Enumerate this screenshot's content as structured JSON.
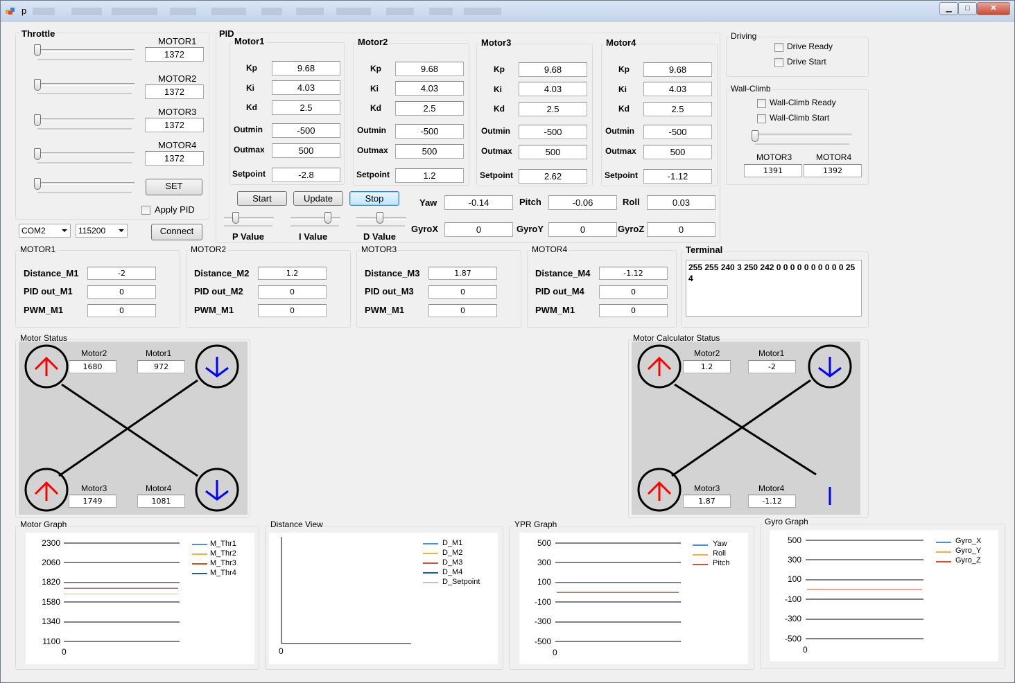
{
  "window": {
    "title": "p"
  },
  "throttle": {
    "title": "Throttle",
    "motors": [
      {
        "label": "MOTOR1",
        "value": "1372"
      },
      {
        "label": "MOTOR2",
        "value": "1372"
      },
      {
        "label": "MOTOR3",
        "value": "1372"
      },
      {
        "label": "MOTOR4",
        "value": "1372"
      }
    ],
    "set_label": "SET",
    "apply_pid_label": "Apply PID",
    "com_port": "COM2",
    "baud_rate": "115200",
    "connect_label": "Connect"
  },
  "pid": {
    "title": "PID",
    "motors": [
      {
        "title": "Motor1",
        "kp": "9.68",
        "ki": "4.03",
        "kd": "2.5",
        "outmin": "-500",
        "outmax": "500",
        "setpoint": "-2.8"
      },
      {
        "title": "Motor2",
        "kp": "9.68",
        "ki": "4.03",
        "kd": "2.5",
        "outmin": "-500",
        "outmax": "500",
        "setpoint": "1.2"
      },
      {
        "title": "Motor3",
        "kp": "9.68",
        "ki": "4.03",
        "kd": "2.5",
        "outmin": "-500",
        "outmax": "500",
        "setpoint": "2.62"
      },
      {
        "title": "Motor4",
        "kp": "9.68",
        "ki": "4.03",
        "kd": "2.5",
        "outmin": "-500",
        "outmax": "500",
        "setpoint": "-1.12"
      }
    ],
    "field_labels": {
      "kp": "Kp",
      "ki": "Ki",
      "kd": "Kd",
      "outmin": "Outmin",
      "outmax": "Outmax",
      "setpoint": "Setpoint"
    },
    "start_label": "Start",
    "update_label": "Update",
    "stop_label": "Stop",
    "p_value_label": "P Value",
    "i_value_label": "I Value",
    "d_value_label": "D Value",
    "ypr": {
      "yaw_label": "Yaw",
      "yaw": "-0.14",
      "pitch_label": "Pitch",
      "pitch": "-0.06",
      "roll_label": "Roll",
      "roll": "0.03"
    },
    "gyro": {
      "x_label": "GyroX",
      "x": "0",
      "y_label": "GyroY",
      "y": "0",
      "z_label": "GyroZ",
      "z": "0"
    }
  },
  "driving": {
    "title": "Driving",
    "ready_label": "Drive Ready",
    "start_label": "Drive Start"
  },
  "wallclimb": {
    "title": "Wall-Climb",
    "ready_label": "Wall-Climb Ready",
    "start_label": "Wall-Climb Start",
    "m3_label": "MOTOR3",
    "m3_value": "1391",
    "m4_label": "MOTOR4",
    "m4_value": "1392"
  },
  "motor_boxes": [
    {
      "title": "MOTOR1",
      "dist_label": "Distance_M1",
      "dist": "-2",
      "pid_label": "PID out_M1",
      "pid": "0",
      "pwm_label": "PWM_M1",
      "pwm": "0"
    },
    {
      "title": "MOTOR2",
      "dist_label": "Distance_M2",
      "dist": "1.2",
      "pid_label": "PID out_M2",
      "pid": "0",
      "pwm_label": "PWM_M1",
      "pwm": "0"
    },
    {
      "title": "MOTOR3",
      "dist_label": "Distance_M3",
      "dist": "1.87",
      "pid_label": "PID out_M3",
      "pid": "0",
      "pwm_label": "PWM_M1",
      "pwm": "0"
    },
    {
      "title": "MOTOR4",
      "dist_label": "Distance_M4",
      "dist": "-1.12",
      "pid_label": "PID out_M4",
      "pid": "0",
      "pwm_label": "PWM_M1",
      "pwm": "0"
    }
  ],
  "terminal": {
    "title": "Terminal",
    "text": "255 255 240 3 250 242 0 0 0 0 0 0 0 0 0 0 254"
  },
  "motor_status": {
    "title": "Motor Status",
    "m2_label": "Motor2",
    "m2": "1680",
    "m1_label": "Motor1",
    "m1": "972",
    "m3_label": "Motor3",
    "m3": "1749",
    "m4_label": "Motor4",
    "m4": "1081"
  },
  "motor_calc_status": {
    "title": "Motor Calculator Status",
    "m2_label": "Motor2",
    "m2": "1.2",
    "m1_label": "Motor1",
    "m1": "-2",
    "m3_label": "Motor3",
    "m3": "1.87",
    "m4_label": "Motor4",
    "m4": "-1.12"
  },
  "colors": {
    "up_arrow": "#ff0000",
    "down_arrow": "#0000ff",
    "s1": "#4a90d9",
    "s2": "#f0b040",
    "s3": "#d9502a",
    "s4": "#1f5f8b",
    "s5": "#c0c0c0"
  },
  "charts": {
    "motor": {
      "title": "Motor Graph",
      "x_tick": "0",
      "y_ticks": [
        "2300",
        "2060",
        "1820",
        "1580",
        "1340",
        "1100"
      ],
      "legend": [
        "M_Thr1",
        "M_Thr2",
        "M_Thr3",
        "M_Thr4"
      ]
    },
    "distance": {
      "title": "Distance View",
      "x_tick": "0",
      "legend": [
        "D_M1",
        "D_M2",
        "D_M3",
        "D_M4",
        "D_Setpoint"
      ]
    },
    "ypr": {
      "title": "YPR Graph",
      "x_tick": "0",
      "y_ticks": [
        "500",
        "300",
        "100",
        "-100",
        "-300",
        "-500"
      ],
      "legend": [
        "Yaw",
        "Roll",
        "Pitch"
      ]
    },
    "gyro": {
      "title": "Gyro Graph",
      "x_tick": "0",
      "y_ticks": [
        "500",
        "300",
        "100",
        "-100",
        "-300",
        "-500"
      ],
      "legend": [
        "Gyro_X",
        "Gyro_Y",
        "Gyro_Z"
      ]
    }
  },
  "chart_data": [
    {
      "type": "line",
      "title": "Motor Graph",
      "ylim": [
        1100,
        2300
      ],
      "grid": true,
      "legend_position": "top-right",
      "series": [
        {
          "name": "M_Thr1",
          "values": [
            1749
          ]
        },
        {
          "name": "M_Thr2",
          "values": [
            1680
          ]
        },
        {
          "name": "M_Thr3",
          "values": [
            1749
          ]
        },
        {
          "name": "M_Thr4",
          "values": [
            1749
          ]
        }
      ]
    },
    {
      "type": "line",
      "title": "Distance View",
      "grid": false,
      "legend_position": "top-right",
      "series": [
        {
          "name": "D_M1",
          "values": []
        },
        {
          "name": "D_M2",
          "values": []
        },
        {
          "name": "D_M3",
          "values": []
        },
        {
          "name": "D_M4",
          "values": []
        },
        {
          "name": "D_Setpoint",
          "values": []
        }
      ]
    },
    {
      "type": "line",
      "title": "YPR Graph",
      "ylim": [
        -500,
        500
      ],
      "grid": true,
      "legend_position": "top-right",
      "series": [
        {
          "name": "Yaw",
          "values": [
            0
          ]
        },
        {
          "name": "Roll",
          "values": [
            0
          ]
        },
        {
          "name": "Pitch",
          "values": [
            0
          ]
        }
      ]
    },
    {
      "type": "line",
      "title": "Gyro Graph",
      "ylim": [
        -500,
        500
      ],
      "grid": true,
      "legend_position": "top-right",
      "series": [
        {
          "name": "Gyro_X",
          "values": [
            0
          ]
        },
        {
          "name": "Gyro_Y",
          "values": [
            0
          ]
        },
        {
          "name": "Gyro_Z",
          "values": [
            0
          ]
        }
      ]
    }
  ]
}
